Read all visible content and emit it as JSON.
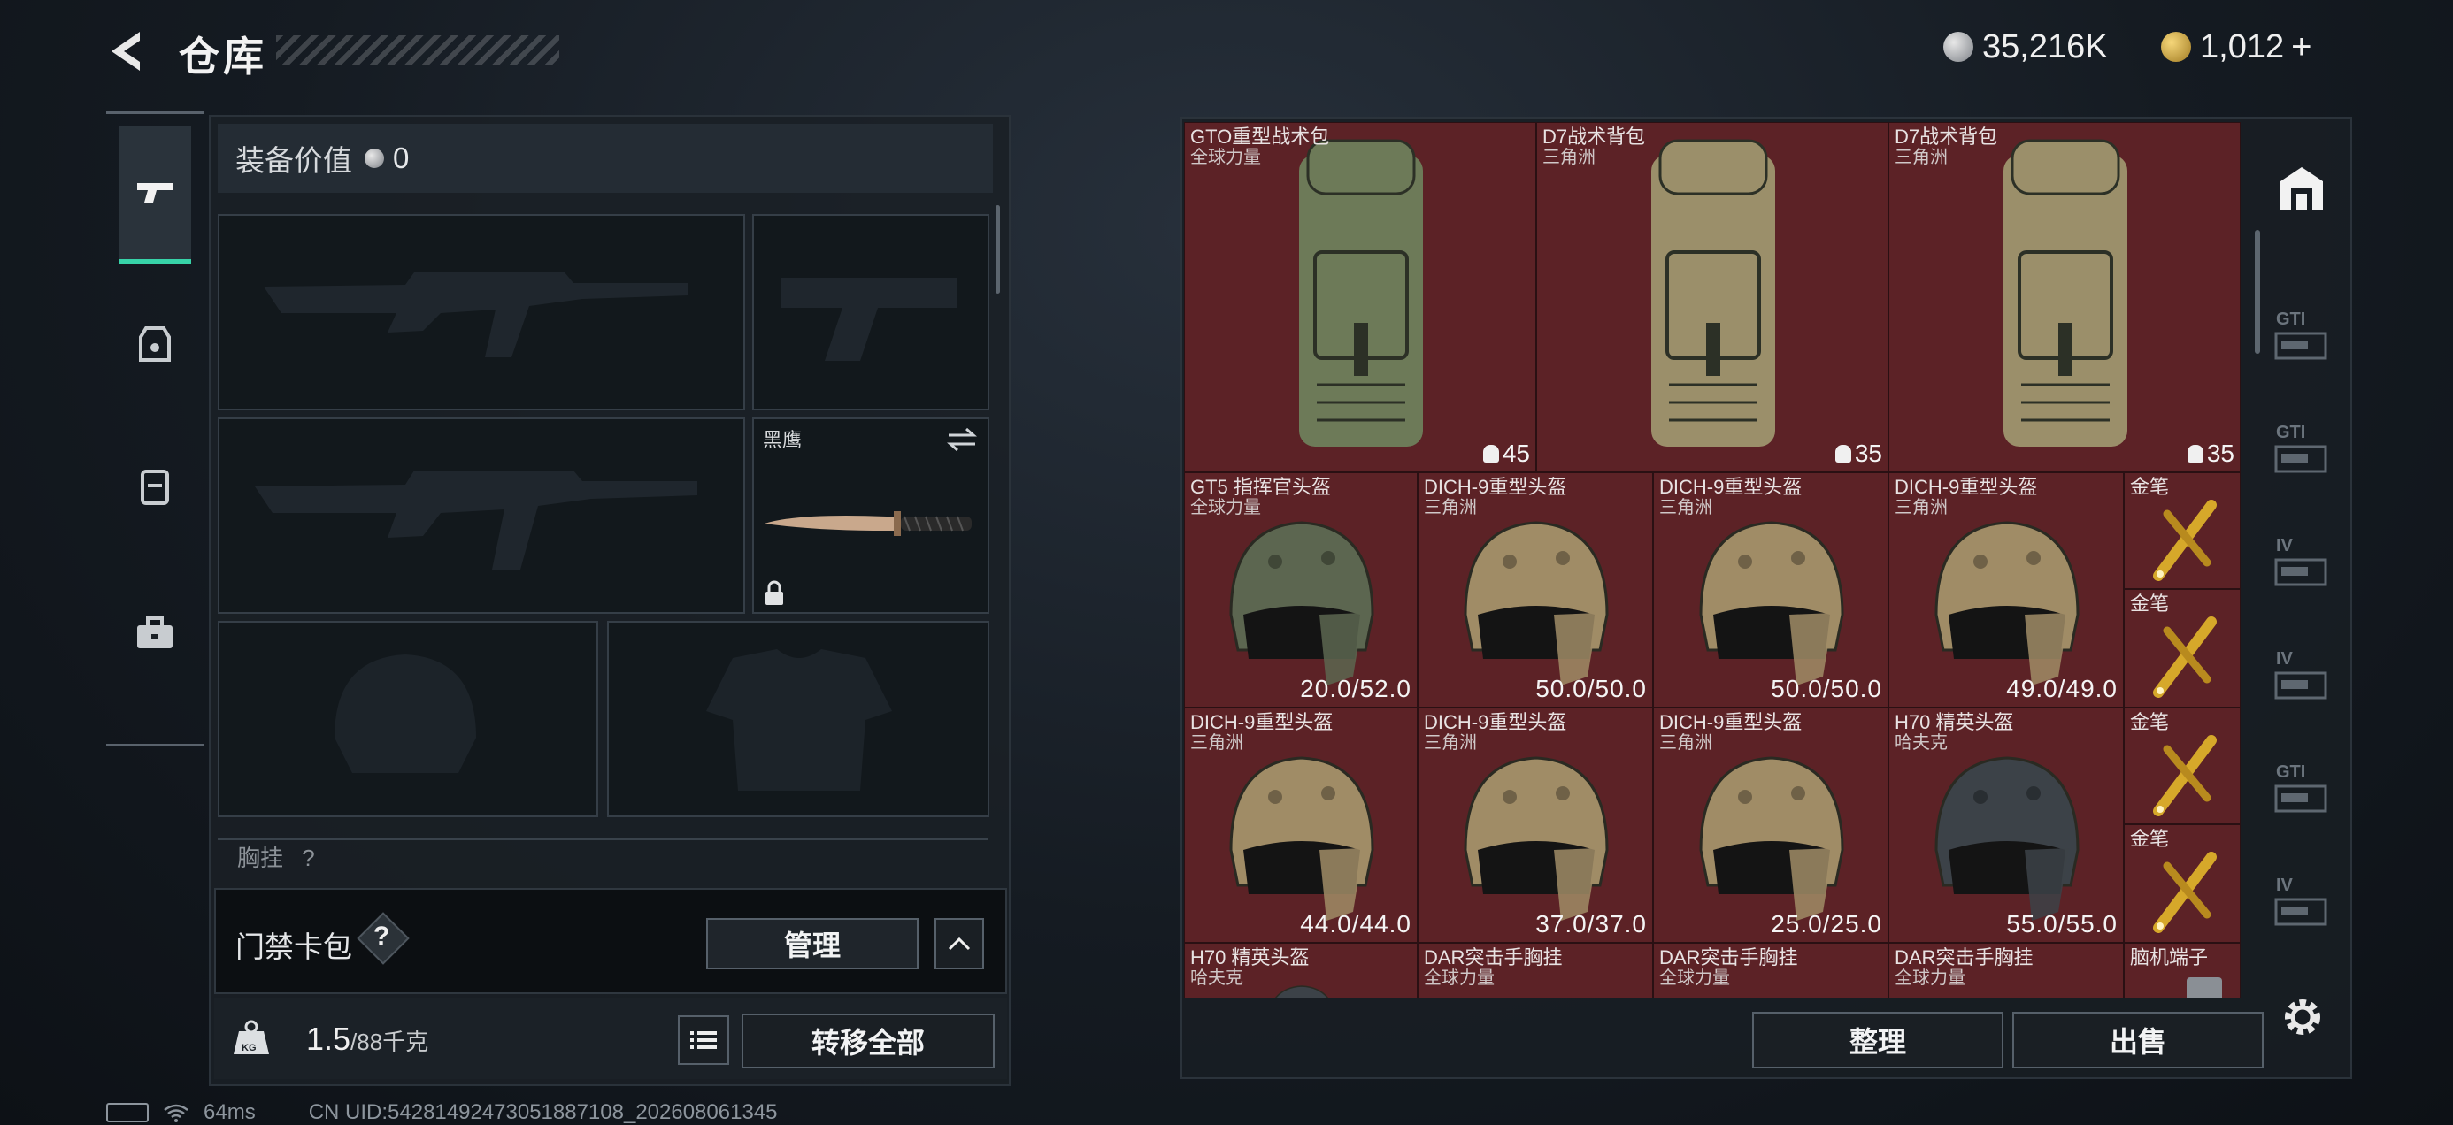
{
  "header": {
    "title": "仓库",
    "currency_silver": "35,216K",
    "currency_gold": "1,012",
    "gold_plus": "+"
  },
  "loadout": {
    "value_label": "装备价值",
    "value": "0",
    "knife_label": "黑鹰",
    "chest_label": "胸挂",
    "chest_q": "?"
  },
  "card_pack": {
    "label": "门禁卡包",
    "help": "?",
    "manage_button": "管理"
  },
  "weight": {
    "current": "1.5",
    "max": "/88",
    "unit": "千克",
    "badge": "KG"
  },
  "transfer_all": "转移全部",
  "inventory": {
    "items": [
      {
        "name": "GTO重型战术包",
        "sub": "全球力量",
        "stat": "45",
        "kind": "bag",
        "color": "#6d7a58"
      },
      {
        "name": "D7战术背包",
        "sub": "三角洲",
        "stat": "35",
        "kind": "bag",
        "color": "#9b8f6a"
      },
      {
        "name": "D7战术背包",
        "sub": "三角洲",
        "stat": "35",
        "kind": "bag",
        "color": "#9b8f6a"
      },
      {
        "name": "GT5 指挥官头盔",
        "sub": "全球力量",
        "stat": "20.0/52.0",
        "kind": "helmet",
        "color": "#5c6650"
      },
      {
        "name": "DICH-9重型头盔",
        "sub": "三角洲",
        "stat": "50.0/50.0",
        "kind": "helmet",
        "color": "#a08c66"
      },
      {
        "name": "DICH-9重型头盔",
        "sub": "三角洲",
        "stat": "50.0/50.0",
        "kind": "helmet",
        "color": "#a08c66"
      },
      {
        "name": "DICH-9重型头盔",
        "sub": "三角洲",
        "stat": "49.0/49.0",
        "kind": "helmet",
        "color": "#a08c66"
      },
      {
        "name": "金笔",
        "sub": "",
        "stat": "",
        "kind": "pen",
        "color": "#d6a82a"
      },
      {
        "name": "金笔",
        "sub": "",
        "stat": "",
        "kind": "pen",
        "color": "#d6a82a"
      },
      {
        "name": "DICH-9重型头盔",
        "sub": "三角洲",
        "stat": "44.0/44.0",
        "kind": "helmet",
        "color": "#a08c66"
      },
      {
        "name": "DICH-9重型头盔",
        "sub": "三角洲",
        "stat": "37.0/37.0",
        "kind": "helmet",
        "color": "#a08c66"
      },
      {
        "name": "DICH-9重型头盔",
        "sub": "三角洲",
        "stat": "25.0/25.0",
        "kind": "helmet",
        "color": "#a08c66"
      },
      {
        "name": "H70 精英头盔",
        "sub": "哈夫克",
        "stat": "55.0/55.0",
        "kind": "helmet",
        "color": "#3c4248"
      },
      {
        "name": "金笔",
        "sub": "",
        "stat": "",
        "kind": "pen",
        "color": "#d6a82a"
      },
      {
        "name": "金笔",
        "sub": "",
        "stat": "",
        "kind": "pen",
        "color": "#d6a82a"
      },
      {
        "name": "H70 精英头盔",
        "sub": "哈夫克",
        "stat": "",
        "kind": "helmet",
        "color": "#3c4248"
      },
      {
        "name": "DAR突击手胸挂",
        "sub": "全球力量",
        "stat": "",
        "kind": "vest",
        "color": "#59604a"
      },
      {
        "name": "DAR突击手胸挂",
        "sub": "全球力量",
        "stat": "",
        "kind": "vest",
        "color": "#59604a"
      },
      {
        "name": "DAR突击手胸挂",
        "sub": "全球力量",
        "stat": "",
        "kind": "vest",
        "color": "#59604a"
      },
      {
        "name": "脑机端子",
        "sub": "",
        "stat": "",
        "kind": "chip",
        "color": "#8a8f95"
      }
    ]
  },
  "right_rail": [
    "GTI",
    "GTI",
    "IV",
    "IV",
    "GTI",
    "IV"
  ],
  "actions": {
    "sort_button": "整理",
    "sell_button": "出售"
  },
  "status": {
    "ping": "64ms",
    "uid": "CN UID:54281492473051887108_202608061345"
  },
  "colors": {
    "accent": "#37d3a8",
    "cell_bg": "#5c2226"
  }
}
